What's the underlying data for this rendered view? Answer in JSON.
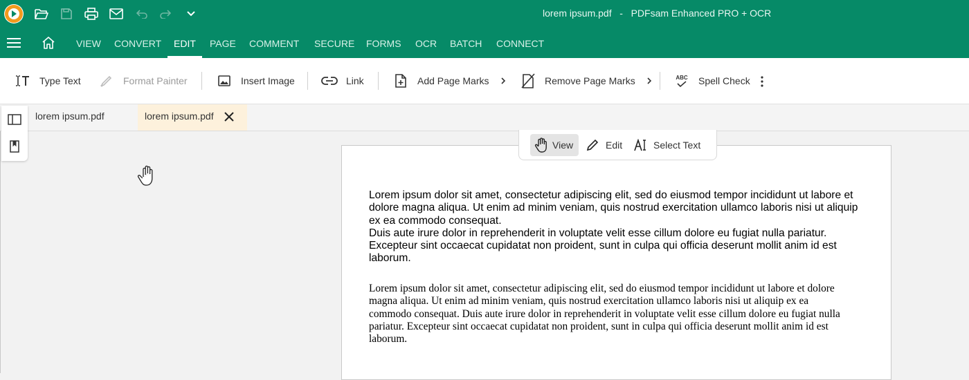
{
  "window": {
    "title": "lorem ipsum.pdf   -   PDFsam Enhanced PRO + OCR"
  },
  "quick_access": {
    "icons": [
      "app-logo-icon",
      "open-folder-icon",
      "save-icon",
      "print-icon",
      "email-icon",
      "undo-icon",
      "redo-icon",
      "customize-chevron-icon"
    ]
  },
  "menu": {
    "items": [
      "VIEW",
      "CONVERT",
      "EDIT",
      "PAGE",
      "COMMENT",
      "SECURE",
      "FORMS",
      "OCR",
      "BATCH",
      "CONNECT"
    ],
    "active": "EDIT"
  },
  "ribbon": {
    "type_text": "Type Text",
    "format_painter": "Format Painter",
    "insert_image": "Insert Image",
    "link": "Link",
    "add_page_marks": "Add Page Marks",
    "remove_page_marks": "Remove Page Marks",
    "spell_check": "Spell Check",
    "spell_check_icon_text": "ABC"
  },
  "tabs": [
    {
      "label": "lorem ipsum.pdf",
      "active": false
    },
    {
      "label": "lorem ipsum.pdf",
      "active": true
    }
  ],
  "mode_toolbar": {
    "view": "View",
    "edit": "Edit",
    "select_text": "Select Text",
    "active": "View"
  },
  "document": {
    "paragraph1_lines": [
      "Lorem ipsum dolor sit amet, consectetur adipiscing elit, sed do eiusmod tempor incididunt ut labore et",
      "dolore magna aliqua. Ut enim ad minim veniam, quis nostrud exercitation ullamco laboris nisi ut aliquip",
      "ex ea commodo consequat.",
      "Duis aute irure dolor in reprehenderit in voluptate velit esse cillum dolore eu fugiat nulla pariatur.",
      "Excepteur sint occaecat cupidatat non proident, sunt in culpa qui officia deserunt mollit anim id est",
      "laborum."
    ],
    "paragraph2_lines": [
      "Lorem ipsum dolor sit amet, consectetur adipiscing elit, sed do eiusmod tempor incididunt ut labore et dolore",
      "magna aliqua. Ut enim ad minim veniam, quis nostrud exercitation ullamco laboris nisi ut aliquip ex ea",
      "commodo consequat. Duis aute irure dolor in reprehenderit in voluptate velit esse cillum dolore eu fugiat nulla",
      "pariatur. Excepteur sint occaecat cupidatat non proident, sunt in culpa qui officia deserunt mollit anim id est",
      "laborum."
    ]
  },
  "colors": {
    "brand_green": "#068a67",
    "active_tab_bg": "#fdf1dc",
    "logo_orange": "#f39a1e"
  }
}
